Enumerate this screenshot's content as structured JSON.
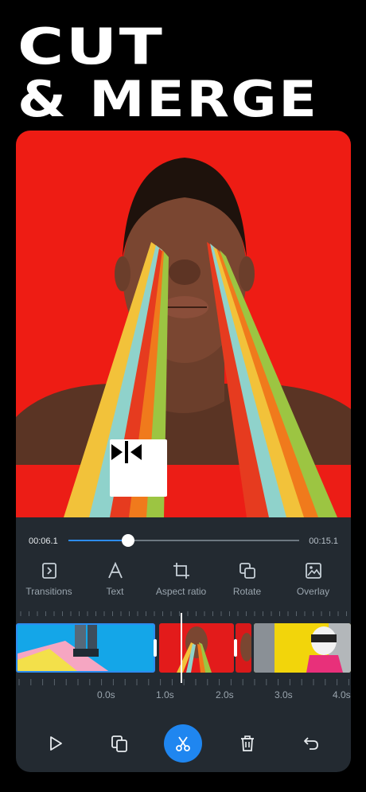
{
  "headline": {
    "line1": "CUT",
    "line2": "& MERGE"
  },
  "player": {
    "current_time": "00:06.1",
    "total_time": "00:15.1",
    "progress": 0.26
  },
  "tools": [
    {
      "label": "Transitions",
      "icon": "transitions-icon"
    },
    {
      "label": "Text",
      "icon": "text-icon"
    },
    {
      "label": "Aspect ratio",
      "icon": "crop-icon"
    },
    {
      "label": "Rotate",
      "icon": "rotate-icon"
    },
    {
      "label": "Overlay",
      "icon": "image-overlay-icon"
    }
  ],
  "timeline": {
    "ruler_labels": [
      "0.0s",
      "1.0s",
      "2.0s",
      "3.0s",
      "4.0s"
    ]
  },
  "actions": [
    {
      "name": "play-button",
      "icon": "play-icon"
    },
    {
      "name": "duplicate-button",
      "icon": "duplicate-icon"
    },
    {
      "name": "cut-button",
      "icon": "scissors-icon"
    },
    {
      "name": "delete-button",
      "icon": "trash-icon"
    },
    {
      "name": "undo-button",
      "icon": "undo-icon"
    }
  ],
  "colors": {
    "accent": "#1F86F0",
    "preview_bg": "#EE1C14",
    "panel": "#232A31"
  }
}
